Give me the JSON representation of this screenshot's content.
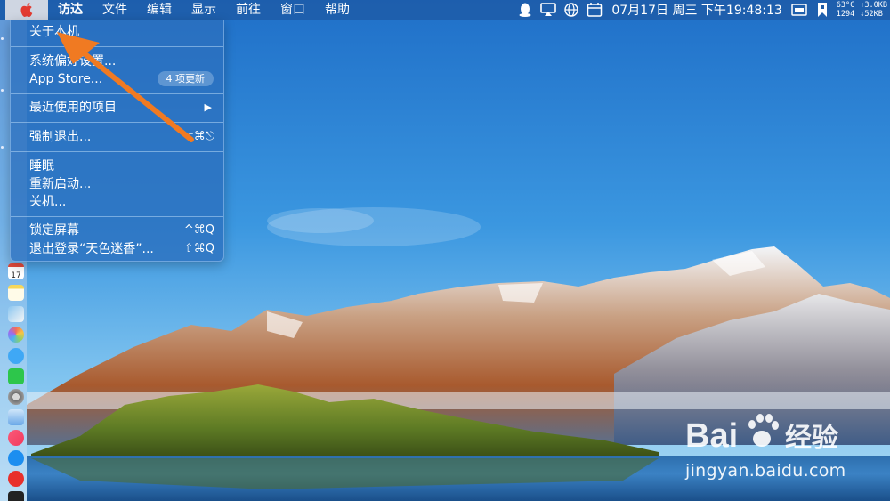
{
  "menubar": {
    "apple_icon": "apple-logo-icon",
    "menus": [
      "访达",
      "文件",
      "编辑",
      "显示",
      "前往",
      "窗口",
      "帮助"
    ],
    "status": {
      "icons": [
        "qq-icon",
        "airplay-icon",
        "globe-icon",
        "calendar-icon"
      ],
      "clock": "07月17日 周三 下午19:48:13",
      "extra_icons": [
        "screen-icon",
        "bookmark-icon"
      ],
      "stats_left": [
        "63°C",
        "1294"
      ],
      "stats_right": [
        "↑3.0KB",
        "↓52KB"
      ]
    }
  },
  "apple_menu": {
    "items": [
      {
        "label": "关于本机",
        "shortcut": ""
      },
      {
        "label": "系统偏好设置...",
        "shortcut": ""
      },
      {
        "label": "App Store...",
        "badge": "4 项更新"
      },
      {
        "label": "最近使用的项目",
        "submenu_arrow": "▶"
      },
      {
        "label": "强制退出...",
        "shortcut": "⌥⌘⎋"
      },
      {
        "label": "睡眠",
        "shortcut": ""
      },
      {
        "label": "重新启动...",
        "shortcut": ""
      },
      {
        "label": "关机...",
        "shortcut": ""
      },
      {
        "label": "锁定屏幕",
        "shortcut": "^⌘Q"
      },
      {
        "label": "退出登录“天色迷香”...",
        "shortcut": "⇧⌘Q"
      }
    ]
  },
  "dock": {
    "icons": [
      "calendar-app-icon",
      "notes-app-icon",
      "preview-app-icon",
      "photos-app-icon",
      "messages-app-icon",
      "wechat-app-icon",
      "system-preferences-icon",
      "downloads-icon",
      "music-app-icon",
      "app-store-icon",
      "vivaldi-app-icon",
      "terminal-app-icon"
    ],
    "calendar_day": "17"
  },
  "watermark": {
    "logo_text": "Bai",
    "logo_text_2": "经验",
    "url": "jingyan.baidu.com"
  },
  "colors": {
    "arrow": "#f07a22",
    "menubar": "#1e5ca8",
    "menu_bg": "#2c70be"
  }
}
